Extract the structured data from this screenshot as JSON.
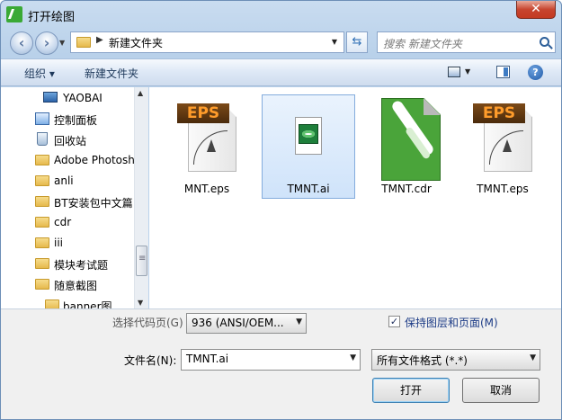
{
  "window": {
    "title": "打开绘图",
    "close_label": "✕"
  },
  "address": {
    "crumb": "新建文件夹"
  },
  "search": {
    "placeholder": "搜索 新建文件夹"
  },
  "toolbar": {
    "organize": "组织 ▾",
    "new_folder": "新建文件夹",
    "help": "?"
  },
  "nav": {
    "items": [
      {
        "label": "YAOBAI",
        "icon": "computer-icon"
      },
      {
        "label": "控制面板",
        "icon": "control-panel-icon"
      },
      {
        "label": "回收站",
        "icon": "recycle-bin-icon"
      },
      {
        "label": "Adobe Photosh",
        "icon": "folder-icon"
      },
      {
        "label": "anli",
        "icon": "folder-icon"
      },
      {
        "label": "BT安装包中文篇",
        "icon": "folder-icon"
      },
      {
        "label": "cdr",
        "icon": "folder-icon"
      },
      {
        "label": "iii",
        "icon": "folder-icon"
      },
      {
        "label": "模块考试题",
        "icon": "folder-icon"
      },
      {
        "label": "随意截图",
        "icon": "folder-icon"
      },
      {
        "label": "banner图",
        "icon": "folder-icon"
      }
    ]
  },
  "files": [
    {
      "name": "MNT.eps",
      "type": "eps",
      "badge": "EPS",
      "selected": false
    },
    {
      "name": "TMNT.ai",
      "type": "ai",
      "selected": true
    },
    {
      "name": "TMNT.cdr",
      "type": "cdr",
      "selected": false
    },
    {
      "name": "TMNT.eps",
      "type": "eps",
      "badge": "EPS",
      "selected": false
    }
  ],
  "bottom": {
    "codepage_label": "选择代码页(G)",
    "codepage_value": "936  (ANSI/OEM...",
    "keep_layers_label": "保持图层和页面(M)",
    "keep_layers_checked": true,
    "filename_label": "文件名(N):",
    "filename_value": "TMNT.ai",
    "filter_value": "所有文件格式 (*.*)",
    "open_label": "打开",
    "cancel_label": "取消"
  }
}
